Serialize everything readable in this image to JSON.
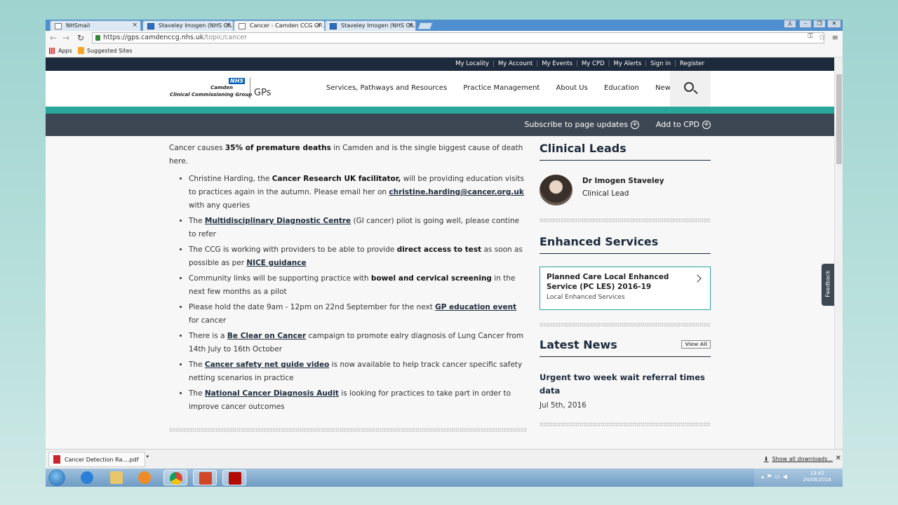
{
  "browser": {
    "tabs": [
      {
        "title": "NHSmail",
        "active": false
      },
      {
        "title": "Staveley Imogen (NHS CA...",
        "active": false
      },
      {
        "title": "Cancer - Camden CCG GP...",
        "active": true
      },
      {
        "title": "Staveley Imogen (NHS CA...",
        "active": false
      }
    ],
    "url_host": "https://gps.camdenccg.nhs.uk",
    "url_path": "/topic/cancer",
    "bookmarks": [
      "Apps",
      "Suggested Sites"
    ]
  },
  "site": {
    "top_links": [
      "My Locality",
      "My Account",
      "My Events",
      "My CPD",
      "My Alerts",
      "Sign in",
      "Register"
    ],
    "logo": {
      "nhs": "NHS",
      "camden": "Camden",
      "ccg": "Clinical Commissioning Group",
      "gps": "GPs"
    },
    "nav": [
      "Services, Pathways and Resources",
      "Practice Management",
      "About Us",
      "Education",
      "News"
    ],
    "actions": {
      "subscribe": "Subscribe to page updates",
      "add_cpd": "Add to CPD"
    }
  },
  "content": {
    "intro_pre": "Cancer causes ",
    "intro_bold": "35% of premature deaths",
    "intro_post": " in Camden and is the single biggest cause of death here.",
    "items": [
      {
        "parts": [
          {
            "t": "Christine Harding, the "
          },
          {
            "t": "Cancer Research UK facilitator,",
            "b": true
          },
          {
            "t": " will be providing education visits to practices again in the autumn. Please email her on "
          },
          {
            "t": "christine.harding@cancer.org.uk",
            "a": true
          },
          {
            "t": " with any queries"
          }
        ]
      },
      {
        "parts": [
          {
            "t": "The "
          },
          {
            "t": "Multidisciplinary Diagnostic Centre",
            "a": true
          },
          {
            "t": " (GI cancer) pilot is going well, please contine to refer"
          }
        ]
      },
      {
        "parts": [
          {
            "t": "The CCG is working with providers to be able to provide "
          },
          {
            "t": "direct access to test",
            "b": true
          },
          {
            "t": " as soon as possible as per "
          },
          {
            "t": "NICE guidance",
            "a": true
          }
        ]
      },
      {
        "parts": [
          {
            "t": "Community links will be supporting practice with "
          },
          {
            "t": "bowel and cervical screening",
            "b": true
          },
          {
            "t": " in the next few months as a pilot"
          }
        ]
      },
      {
        "parts": [
          {
            "t": "Please hold the date 9am - 12pm on 22nd September for the next "
          },
          {
            "t": "GP education event",
            "a": true
          },
          {
            "t": " for cancer"
          }
        ]
      },
      {
        "parts": [
          {
            "t": "There is a "
          },
          {
            "t": "Be Clear on Cancer",
            "a": true
          },
          {
            "t": " campaign to promote ealry diagnosis of Lung Cancer from 14th July to 16th October"
          }
        ]
      },
      {
        "parts": [
          {
            "t": "The "
          },
          {
            "t": "Cancer safety net guide video",
            "a": true
          },
          {
            "t": " is now available to help track cancer specific safety netting scenarios in practice"
          }
        ]
      },
      {
        "parts": [
          {
            "t": "The "
          },
          {
            "t": "National Cancer Diagnosis Audit",
            "a": true
          },
          {
            "t": " is looking for practices to take part in order to improve cancer outcomes"
          }
        ]
      }
    ]
  },
  "sidebar": {
    "clinical_leads_title": "Clinical Leads",
    "lead_name": "Dr Imogen Staveley",
    "lead_role": "Clinical Lead",
    "enhanced_title": "Enhanced Services",
    "card_title": "Planned Care Local Enhanced Service (PC LES) 2016-19",
    "card_sub": "Local Enhanced Services",
    "news_title": "Latest News",
    "view_all": "View All",
    "news_item_title": "Urgent two week wait referral times data",
    "news_item_date": "Jul 5th, 2016"
  },
  "feedback": "Feedback",
  "downloads": {
    "file": "Cancer Detection Ra....pdf",
    "show_all": "Show all downloads..."
  },
  "taskbar": {
    "time": "13:42",
    "date": "24/08/2016"
  }
}
